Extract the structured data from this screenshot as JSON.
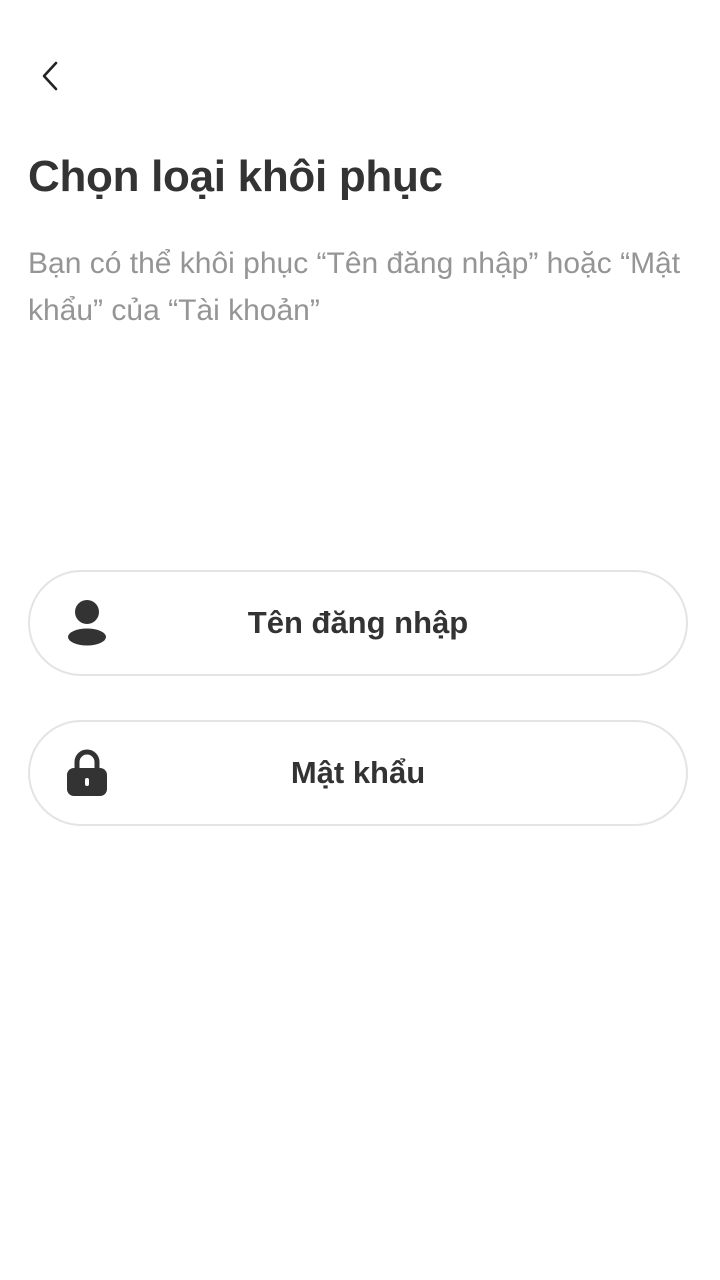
{
  "header": {
    "back_icon": "chevron-left-icon"
  },
  "page": {
    "title": "Chọn loại khôi phục",
    "subtitle": "Bạn có thể khôi phục “Tên đăng nhập” hoặc “Mật khẩu” của “Tài khoản”"
  },
  "options": [
    {
      "label": "Tên đăng nhập",
      "icon": "user-icon"
    },
    {
      "label": "Mật khẩu",
      "icon": "lock-icon"
    }
  ],
  "colors": {
    "text_primary": "#333333",
    "text_secondary": "#959595",
    "border": "#e4e4e4",
    "background": "#ffffff"
  }
}
